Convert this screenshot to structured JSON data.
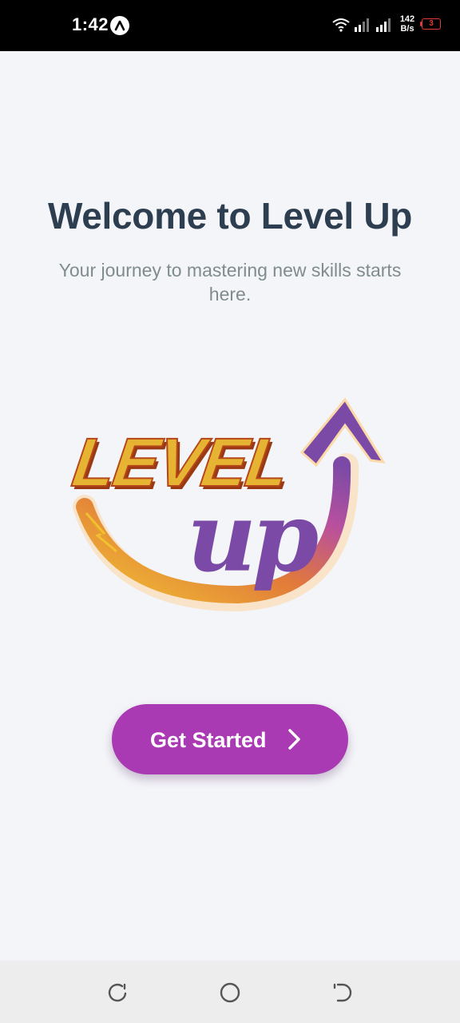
{
  "status_bar": {
    "time": "1:42",
    "net_speed_value": "142",
    "net_speed_unit": "B/s",
    "battery_level": "3",
    "icons": [
      "a-icon",
      "wifi-icon",
      "signal-icon",
      "signal-icon",
      "battery-icon"
    ],
    "battery_color": "#e23b3b"
  },
  "main": {
    "title": "Welcome to Level Up",
    "subtitle": "Your journey to mastering new skills starts here.",
    "logo": {
      "text_level": "LEVEL",
      "text_up": "up"
    },
    "button": {
      "label": "Get Started",
      "icon": "chevron-right-icon"
    }
  },
  "nav_bar": {
    "icons": [
      "recents-icon",
      "home-icon",
      "back-icon"
    ]
  },
  "colors": {
    "background": "#f4f5f9",
    "title": "#2c3e50",
    "subtitle": "#7f8c8d",
    "button": "#a93ab3",
    "logo_purple": "#7b4aa6",
    "logo_yellow": "#e6b432",
    "logo_outline": "#9a3a14"
  }
}
